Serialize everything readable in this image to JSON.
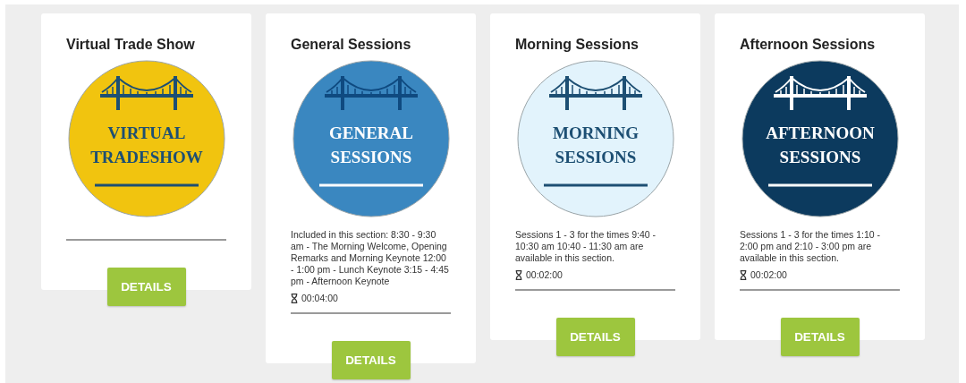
{
  "cards": [
    {
      "title": "Virtual Trade Show",
      "badge": {
        "color": "#f1c40f",
        "lines": [
          "VIRTUAL",
          "TRADESHOW"
        ]
      },
      "button": "DETAILS"
    },
    {
      "title": "General Sessions",
      "badge": {
        "color": "#3a87c0",
        "lines": [
          "GENERAL",
          "SESSIONS"
        ]
      },
      "description": "Included in this section: 8:30 - 9:30 am - The Morning Welcome, Opening Remarks and Morning Keynote 12:00 - 1:00 pm - Lunch Keynote 3:15 - 4:45 pm - Afternoon Keynote",
      "duration": "00:04:00",
      "button": "DETAILS"
    },
    {
      "title": "Morning Sessions",
      "badge": {
        "color": "#e2f3fc",
        "lines": [
          "MORNING",
          "SESSIONS"
        ]
      },
      "description": "Sessions 1 - 3 for the times 9:40 - 10:30 am 10:40 - 11:30 am are available in this section.",
      "duration": "00:02:00",
      "button": "DETAILS"
    },
    {
      "title": "Afternoon Sessions",
      "badge": {
        "color": "#0c3a5e",
        "lines": [
          "AFTERNOON",
          "SESSIONS"
        ]
      },
      "description": "Sessions 1 - 3 for the times 1:10 - 2:00 pm and 2:10 - 3:00 pm are available in this section.",
      "duration": "00:02:00",
      "button": "DETAILS"
    }
  ]
}
